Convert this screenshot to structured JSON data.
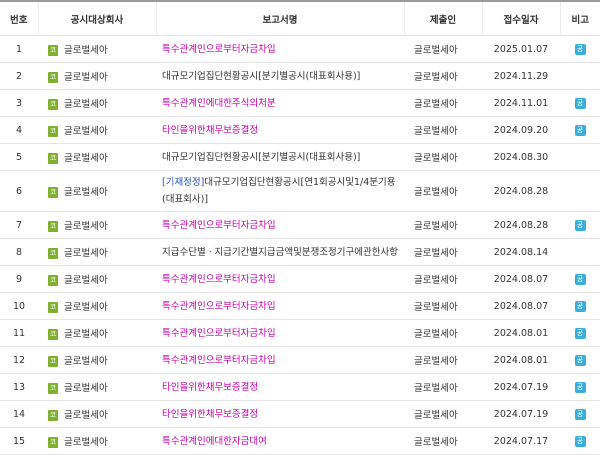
{
  "header": {
    "no": "번호",
    "company": "공시대상회사",
    "report": "보고서명",
    "submitter": "제출인",
    "date": "접수일자",
    "note": "비고"
  },
  "market_badge": "코",
  "note_badge": "공",
  "colors": {
    "link": "#c400a8",
    "tag": "#2a53b8",
    "market_badge": "#7faf2f",
    "note_badge": "#3aaed8"
  },
  "rows": [
    {
      "no": "1",
      "company": "글로벌세아",
      "tag": "",
      "report": "특수관계인으로부터자금차입",
      "submitter": "글로벌세아",
      "date": "2025.01.07",
      "link": true,
      "note": true
    },
    {
      "no": "2",
      "company": "글로벌세아",
      "tag": "",
      "report": "대규모기업집단현황공시[분기별공시(대표회사용)]",
      "submitter": "글로벌세아",
      "date": "2024.11.29",
      "link": false,
      "note": false
    },
    {
      "no": "3",
      "company": "글로벌세아",
      "tag": "",
      "report": "특수관계인에대한주식의처분",
      "submitter": "글로벌세아",
      "date": "2024.11.01",
      "link": true,
      "note": true
    },
    {
      "no": "4",
      "company": "글로벌세아",
      "tag": "",
      "report": "타인을위한채무보증결정",
      "submitter": "글로벌세아",
      "date": "2024.09.20",
      "link": true,
      "note": true
    },
    {
      "no": "5",
      "company": "글로벌세아",
      "tag": "",
      "report": "대규모기업집단현황공시[분기별공시(대표회사용)]",
      "submitter": "글로벌세아",
      "date": "2024.08.30",
      "link": false,
      "note": false
    },
    {
      "no": "6",
      "company": "글로벌세아",
      "tag": "[기재정정]",
      "report": "대규모기업집단현황공시[연1회공시및1/4분기용(대표회사)]",
      "submitter": "글로벌세아",
      "date": "2024.08.28",
      "link": false,
      "note": false
    },
    {
      "no": "7",
      "company": "글로벌세아",
      "tag": "",
      "report": "특수관계인으로부터자금차입",
      "submitter": "글로벌세아",
      "date": "2024.08.28",
      "link": true,
      "note": true
    },
    {
      "no": "8",
      "company": "글로벌세아",
      "tag": "",
      "report": "지급수단별ㆍ지급기간별지급금액및분쟁조정기구에관한사항",
      "submitter": "글로벌세아",
      "date": "2024.08.14",
      "link": false,
      "note": false
    },
    {
      "no": "9",
      "company": "글로벌세아",
      "tag": "",
      "report": "특수관계인으로부터자금차입",
      "submitter": "글로벌세아",
      "date": "2024.08.07",
      "link": true,
      "note": true
    },
    {
      "no": "10",
      "company": "글로벌세아",
      "tag": "",
      "report": "특수관계인으로부터자금차입",
      "submitter": "글로벌세아",
      "date": "2024.08.07",
      "link": true,
      "note": true
    },
    {
      "no": "11",
      "company": "글로벌세아",
      "tag": "",
      "report": "특수관계인으로부터자금차입",
      "submitter": "글로벌세아",
      "date": "2024.08.01",
      "link": true,
      "note": true
    },
    {
      "no": "12",
      "company": "글로벌세아",
      "tag": "",
      "report": "특수관계인으로부터자금차입",
      "submitter": "글로벌세아",
      "date": "2024.08.01",
      "link": true,
      "note": true
    },
    {
      "no": "13",
      "company": "글로벌세아",
      "tag": "",
      "report": "타인을위한채무보증결정",
      "submitter": "글로벌세아",
      "date": "2024.07.19",
      "link": true,
      "note": true
    },
    {
      "no": "14",
      "company": "글로벌세아",
      "tag": "",
      "report": "타인을위한채무보증결정",
      "submitter": "글로벌세아",
      "date": "2024.07.19",
      "link": true,
      "note": true
    },
    {
      "no": "15",
      "company": "글로벌세아",
      "tag": "",
      "report": "특수관계인에대한자금대여",
      "submitter": "글로벌세아",
      "date": "2024.07.17",
      "link": true,
      "note": true
    }
  ]
}
